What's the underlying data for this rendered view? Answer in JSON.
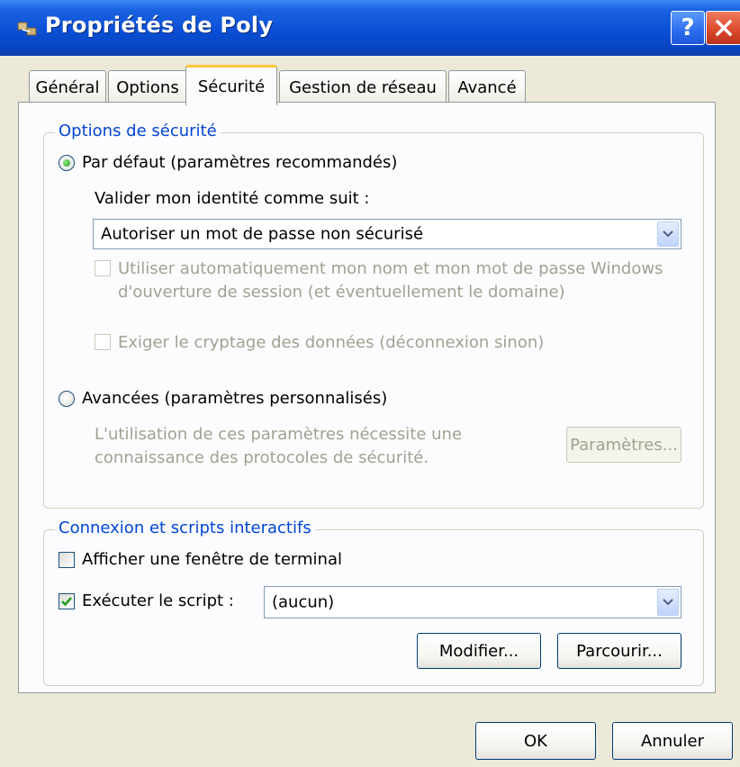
{
  "window": {
    "title": "Propriétés de Poly",
    "help_label": "?",
    "close_label": "×"
  },
  "tabs": [
    {
      "label": "Général",
      "active": false
    },
    {
      "label": "Options",
      "active": false
    },
    {
      "label": "Sécurité",
      "active": true
    },
    {
      "label": "Gestion de réseau",
      "active": false
    },
    {
      "label": "Avancé",
      "active": false
    }
  ],
  "security": {
    "legend": "Options de sécurité",
    "default_radio": {
      "label": "Par défaut (paramètres recommandés)",
      "checked": true
    },
    "validate_label": "Valider mon identité comme suit :",
    "identity_select": {
      "value": "Autoriser un mot de passe non sécurisé"
    },
    "auto_windows": {
      "line1": "Utiliser automatiquement mon nom et mon mot de passe Windows",
      "line2": "d'ouverture de session (et éventuellement le domaine)",
      "checked": false,
      "enabled": false
    },
    "require_encryption": {
      "label": "Exiger le cryptage des données (déconnexion sinon)",
      "checked": false,
      "enabled": false
    },
    "advanced_radio": {
      "label": "Avancées (paramètres personnalisés)",
      "checked": false
    },
    "advanced_note": {
      "line1": "L'utilisation de ces paramètres nécessite une",
      "line2": "connaissance des protocoles de sécurité."
    },
    "params_button": "Paramètres..."
  },
  "scripts": {
    "legend": "Connexion et scripts interactifs",
    "show_terminal": {
      "label": "Afficher une fenêtre de terminal",
      "checked": false
    },
    "run_script": {
      "label": "Exécuter le script :",
      "checked": true
    },
    "script_select": {
      "value": "(aucun)"
    },
    "modify_button": "Modifier...",
    "browse_button": "Parcourir..."
  },
  "footer": {
    "ok_button": "OK",
    "cancel_button": "Annuler"
  },
  "colors": {
    "title_bar": "#0a4fd6",
    "group_legend": "#0046d5",
    "tab_highlight": "#ffc83c",
    "dialog_bg": "#ece9d8"
  }
}
